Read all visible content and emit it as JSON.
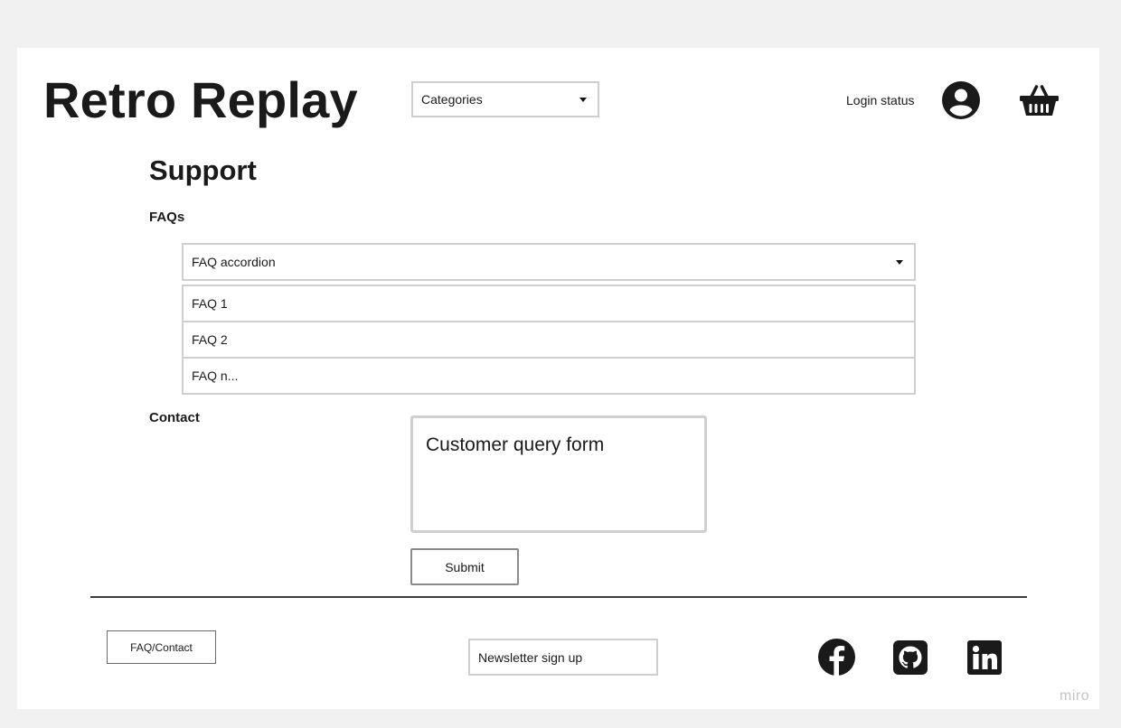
{
  "header": {
    "logo_text": "Retro Replay",
    "categories_label": "Categories",
    "login_status": "Login status",
    "icons": {
      "account": "user-circle-icon",
      "basket": "basket-icon"
    }
  },
  "main": {
    "title": "Support",
    "faqs_label": "FAQs",
    "faq_accordion_label": "FAQ accordion",
    "faq_items": [
      "FAQ 1",
      "FAQ 2",
      "FAQ n..."
    ],
    "contact_label": "Contact",
    "query_form_placeholder": "Customer query form",
    "submit_label": "Submit"
  },
  "footer": {
    "faq_contact_label": "FAQ/Contact",
    "newsletter_label": "Newsletter sign up",
    "social_icons": [
      "facebook-icon",
      "github-icon",
      "linkedin-icon"
    ]
  },
  "watermark": "miro"
}
